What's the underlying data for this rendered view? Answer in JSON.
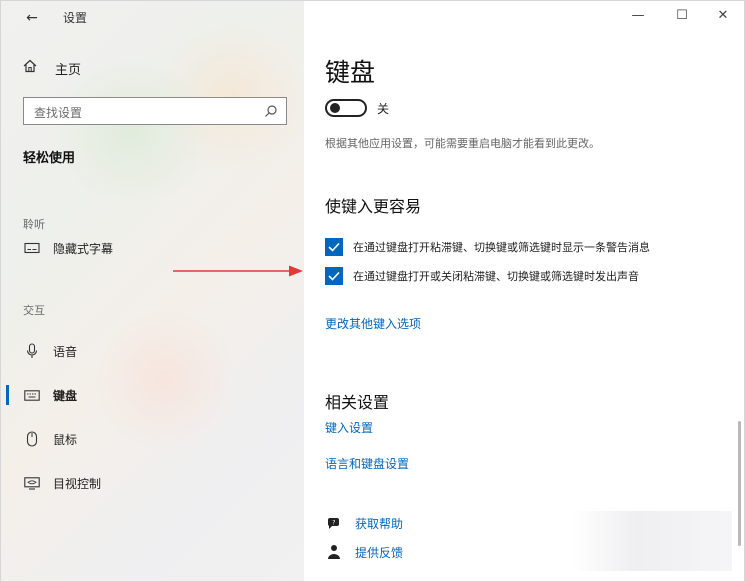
{
  "window": {
    "title": "设置",
    "controls": {
      "minimize": "—",
      "maximize": "☐",
      "close": "✕"
    }
  },
  "sidebar": {
    "back_icon": "arrow-left-icon",
    "home_label": "主页",
    "search": {
      "placeholder": "查找设置"
    },
    "category": "轻松使用",
    "groups": [
      {
        "label": "聆听",
        "items": [
          {
            "label": "隐藏式字幕",
            "icon": "captions-icon"
          }
        ]
      },
      {
        "label": "交互",
        "items": [
          {
            "label": "语音",
            "icon": "microphone-icon"
          },
          {
            "label": "键盘",
            "icon": "keyboard-icon",
            "active": true
          },
          {
            "label": "鼠标",
            "icon": "mouse-icon"
          },
          {
            "label": "目视控制",
            "icon": "eye-control-icon"
          }
        ]
      }
    ]
  },
  "main": {
    "title": "键盘",
    "toggle": {
      "label": "关",
      "state": "off"
    },
    "note": "根据其他应用设置，可能需要重启电脑才能看到此更改。",
    "section1": {
      "title": "使键入更容易",
      "checkboxes": [
        {
          "label": "在通过键盘打开粘滞键、切换键或筛选键时显示一条警告消息",
          "checked": true
        },
        {
          "label": "在通过键盘打开或关闭粘滞键、切换键或筛选键时发出声音",
          "checked": true
        }
      ],
      "link": "更改其他键入选项"
    },
    "section2": {
      "title": "相关设置",
      "links": [
        "键入设置",
        "语言和键盘设置"
      ]
    },
    "help": [
      {
        "label": "获取帮助",
        "icon": "help-chat-icon"
      },
      {
        "label": "提供反馈",
        "icon": "feedback-icon"
      }
    ]
  },
  "colors": {
    "accent": "#0067c0",
    "annotation_arrow": "#e53935"
  }
}
